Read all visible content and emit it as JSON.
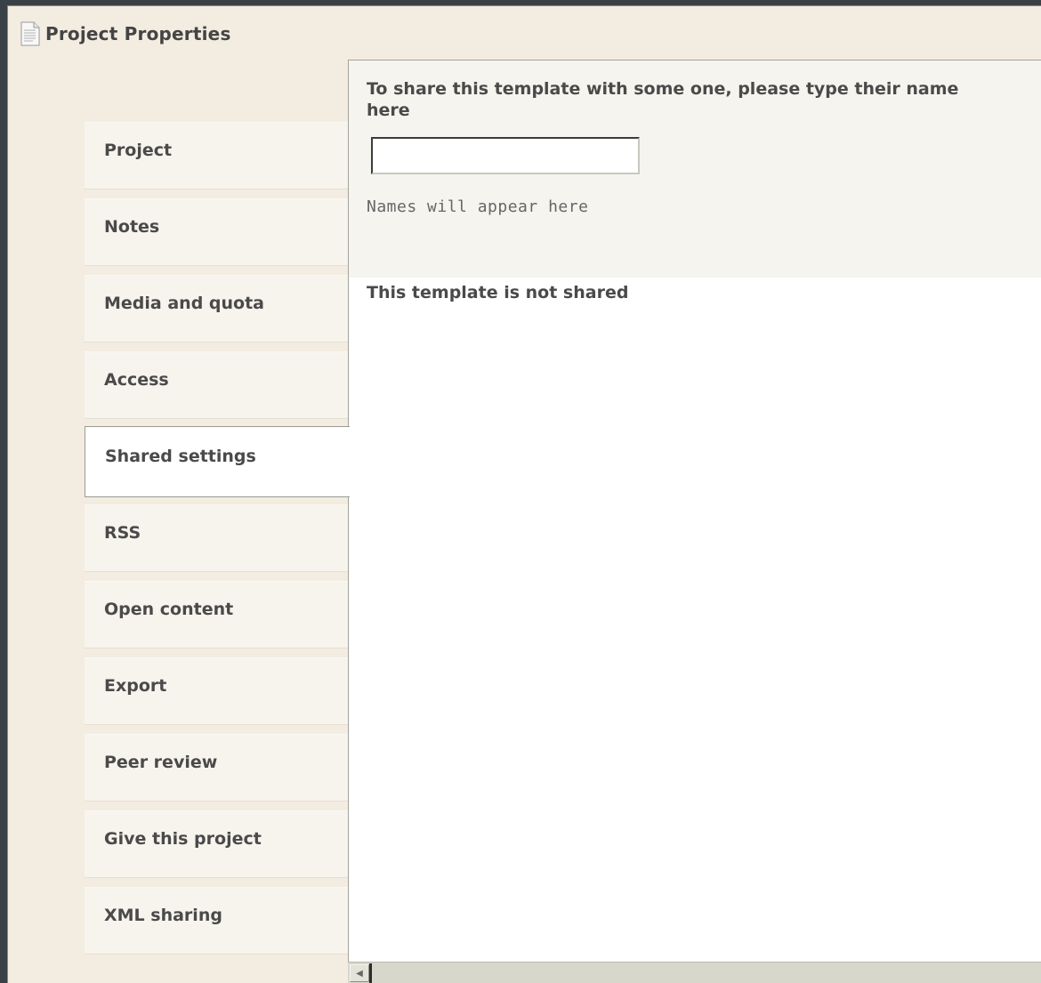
{
  "window": {
    "title": "Project Properties",
    "icon": "document-icon"
  },
  "nav": {
    "items": [
      {
        "label": "Project"
      },
      {
        "label": "Notes"
      },
      {
        "label": "Media and quota"
      },
      {
        "label": "Access"
      },
      {
        "label": "Shared settings",
        "active": true
      },
      {
        "label": "RSS"
      },
      {
        "label": "Open content"
      },
      {
        "label": "Export"
      },
      {
        "label": "Peer review"
      },
      {
        "label": "Give this project"
      },
      {
        "label": "XML sharing"
      }
    ]
  },
  "share": {
    "prompt": "To share this template with some one, please type their name here",
    "input_value": "",
    "names_hint": "Names will appear here",
    "status": "This template is not shared"
  },
  "scrollbar": {
    "left_arrow_icon": "scroll-left-arrow-icon"
  },
  "colors": {
    "window_bg": "#f3ece1",
    "panel_bg": "#f6f4ef",
    "content_bg": "#ffffff",
    "text": "#4a4a4a",
    "desktop_bg": "#3a4146"
  }
}
